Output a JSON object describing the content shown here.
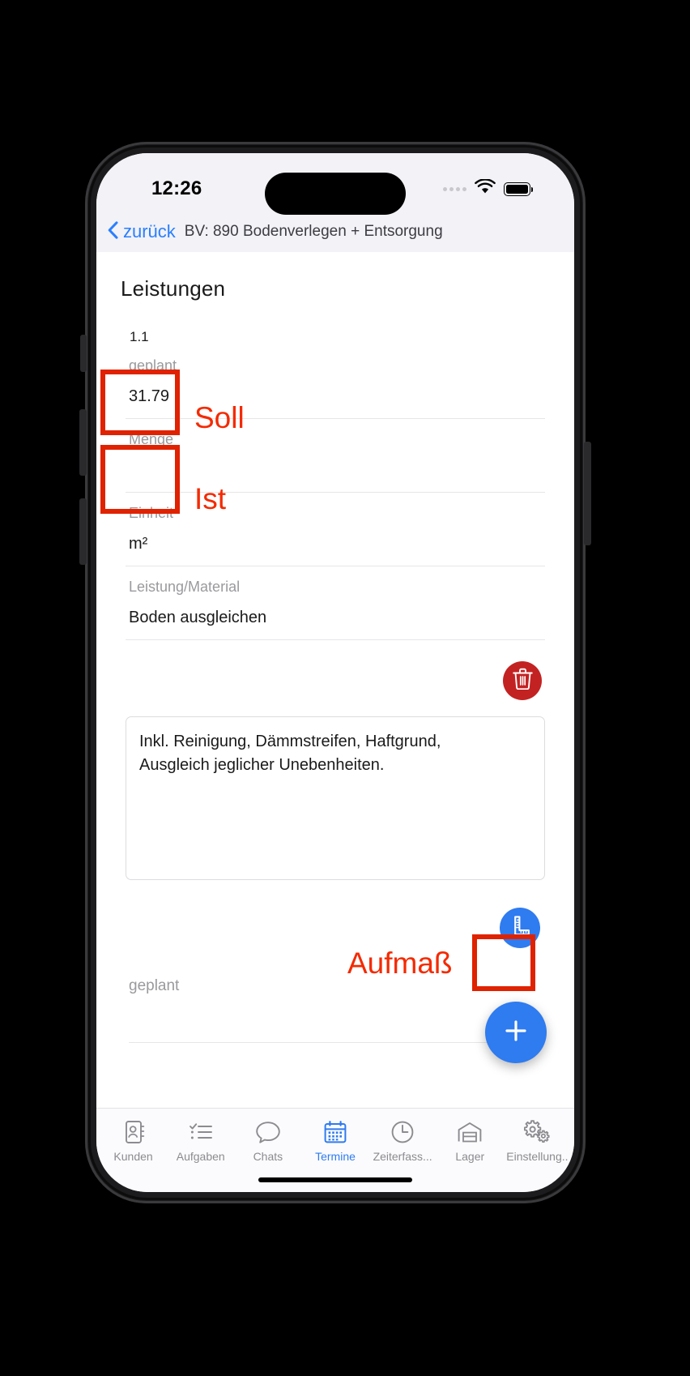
{
  "status_bar": {
    "time": "12:26",
    "wifi_icon": "wifi-icon",
    "battery_icon": "battery-icon",
    "signal_icon": "signal-dots-icon"
  },
  "nav": {
    "back_icon": "chevron-left-icon",
    "back_label": "zurück",
    "title": "BV: 890 Bodenverlegen + Entsorgung"
  },
  "page": {
    "title": "Leistungen",
    "item_index": "1.1"
  },
  "fields": [
    {
      "label": "geplant",
      "value": "31.79",
      "name": "geplant-field"
    },
    {
      "label": "Menge",
      "value": "",
      "name": "menge-field"
    },
    {
      "label": "Einheit",
      "value": "m²",
      "name": "einheit-field"
    },
    {
      "label": "Leistung/Material",
      "value": "Boden ausgleichen",
      "name": "leistung-material-field"
    }
  ],
  "notes": {
    "text": "Inkl. Reinigung, Dämmstreifen, Haftgrund,\nAusgleich jeglicher Unebenheiten."
  },
  "actions": {
    "delete_icon": "trash-icon",
    "measure_icon": "ruler-icon",
    "add_icon": "plus-icon"
  },
  "bottom_section": {
    "label": "geplant"
  },
  "annotations": [
    {
      "text": "Soll",
      "name": "annotation-soll"
    },
    {
      "text": "Ist",
      "name": "annotation-ist"
    },
    {
      "text": "Aufmaß",
      "name": "annotation-aufmass"
    }
  ],
  "tabbar": {
    "items": [
      {
        "label": "Kunden",
        "icon": "contacts-icon",
        "active": false
      },
      {
        "label": "Aufgaben",
        "icon": "checklist-icon",
        "active": false
      },
      {
        "label": "Chats",
        "icon": "chat-icon",
        "active": false
      },
      {
        "label": "Termine",
        "icon": "calendar-icon",
        "active": true
      },
      {
        "label": "Zeiterfass...",
        "icon": "clock-icon",
        "active": false
      },
      {
        "label": "Lager",
        "icon": "warehouse-icon",
        "active": false
      },
      {
        "label": "Einstellung..",
        "icon": "gears-icon",
        "active": false
      }
    ]
  },
  "colors": {
    "accent_blue": "#2f7bf0",
    "annotation_red": "#f42a00",
    "delete_red": "#c32222",
    "label_gray": "#9a9a9e"
  }
}
